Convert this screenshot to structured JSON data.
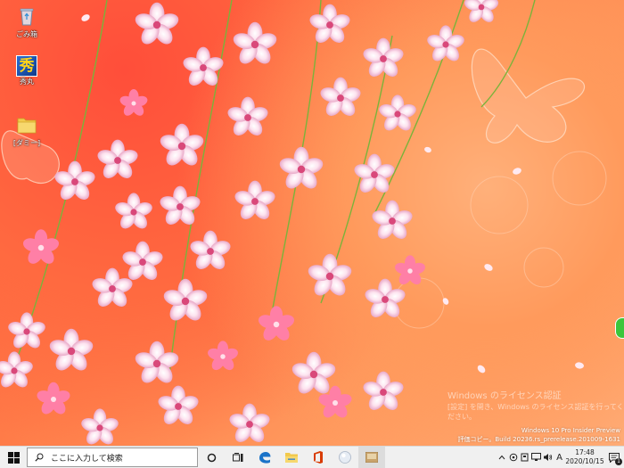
{
  "desktop": {
    "icons": [
      {
        "label": "ごみ箱",
        "icon": "recycle-bin-icon"
      },
      {
        "label": "秀丸",
        "icon": "hidemaru-app-icon"
      },
      {
        "label": "[ダミー]",
        "icon": "folder-icon"
      }
    ],
    "hidemaru_logo": "秀"
  },
  "activation": {
    "title": "Windows のライセンス認証",
    "line1": "[設定] を開き、Windows のライセンス認証を行ってください。"
  },
  "watermark": {
    "edition": "Windows 10 Pro Insider Preview",
    "build": "評価コピー。Build 20236.rs_prerelease.201009-1631"
  },
  "taskbar": {
    "search_placeholder": "ここに入力して検索",
    "pinned": [
      "cortana-icon",
      "task-view-icon",
      "edge-icon",
      "file-explorer-icon",
      "office-icon",
      "orb-app-icon",
      "app-icon"
    ],
    "tray": {
      "ime_mode": "A",
      "time": "17:48",
      "date": "2020/10/15",
      "notifications": "1"
    }
  },
  "colors": {
    "taskbar_bg": "#f0f0f0",
    "accent_green": "#3cc63c",
    "edge_blue": "#1a73c8",
    "office_red": "#d83b01"
  }
}
